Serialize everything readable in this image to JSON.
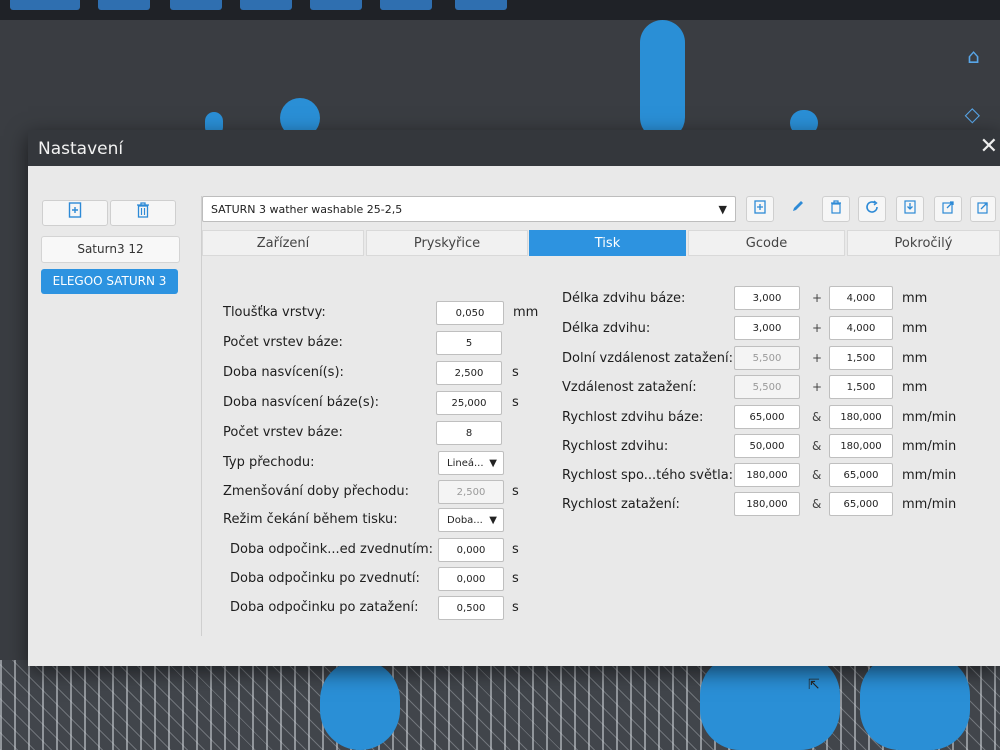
{
  "window": {
    "title": "Nastavení"
  },
  "icons": {
    "close": "close-icon",
    "add": "add-icon",
    "delete": "trash-icon",
    "dropdown": "chevron-down-icon",
    "home": "home-icon",
    "edit": "pencil-icon"
  },
  "glyphs": {
    "dropdown": "▼",
    "close": "✕",
    "cursor": "⇱"
  },
  "printers": [
    "Saturn3 12",
    "ELEGOO SATURN 3"
  ],
  "profile": {
    "selected": "SATURN 3 wather washable 25-2,5"
  },
  "tabs": [
    "Zařízení",
    "Pryskyřice",
    "Tisk",
    "Gcode",
    "Pokročilý"
  ],
  "active_tab": "Tisk",
  "left_settings": [
    {
      "label": "Tloušťka vrstvy:",
      "value": "0,050",
      "unit": "mm"
    },
    {
      "label": "Počet vrstev báze:",
      "value": "5",
      "unit": ""
    },
    {
      "label": "Doba nasvícení(s):",
      "value": "2,500",
      "unit": "s"
    },
    {
      "label": "Doba nasvícení báze(s):",
      "value": "25,000",
      "unit": "s"
    },
    {
      "label": "Počet vrstev báze:",
      "value": "8",
      "unit": ""
    },
    {
      "label": "Typ přechodu:",
      "value": "Lineá...",
      "unit": ""
    },
    {
      "label": "Zmenšování doby přechodu:",
      "value": "2,500",
      "unit": "s"
    },
    {
      "label": "Režim čekání během tisku:",
      "value": "Doba...",
      "unit": ""
    },
    {
      "label": "Doba odpočink...ed zvednutím:",
      "value": "0,000",
      "unit": "s"
    },
    {
      "label": "Doba odpočinku po zvednutí:",
      "value": "0,000",
      "unit": "s"
    },
    {
      "label": "Doba odpočinku po zatažení:",
      "value": "0,500",
      "unit": "s"
    }
  ],
  "right_settings": [
    {
      "label": "Délka zdvihu báze:",
      "value1": "3,000",
      "op": "+",
      "value2": "4,000",
      "unit": "mm"
    },
    {
      "label": "Délka zdvihu:",
      "value1": "3,000",
      "op": "+",
      "value2": "4,000",
      "unit": "mm"
    },
    {
      "label": "Dolní vzdálenost zatažení:",
      "value1": "5,500",
      "op": "+",
      "value2": "1,500",
      "unit": "mm"
    },
    {
      "label": "Vzdálenost zatažení:",
      "value1": "5,500",
      "op": "+",
      "value2": "1,500",
      "unit": "mm"
    },
    {
      "label": "Rychlost zdvihu báze:",
      "value1": "65,000",
      "op": "&",
      "value2": "180,000",
      "unit": "mm/min"
    },
    {
      "label": "Rychlost zdvihu:",
      "value1": "50,000",
      "op": "&",
      "value2": "180,000",
      "unit": "mm/min"
    },
    {
      "label": "Rychlost spo...tého světla:",
      "value1": "180,000",
      "op": "&",
      "value2": "65,000",
      "unit": "mm/min"
    },
    {
      "label": "Rychlost zatažení:",
      "value1": "180,000",
      "op": "&",
      "value2": "65,000",
      "unit": "mm/min"
    }
  ],
  "colors": {
    "accent": "#2d93e0",
    "titlebar": "#34373c",
    "dialog_bg": "#e9e9e9"
  }
}
